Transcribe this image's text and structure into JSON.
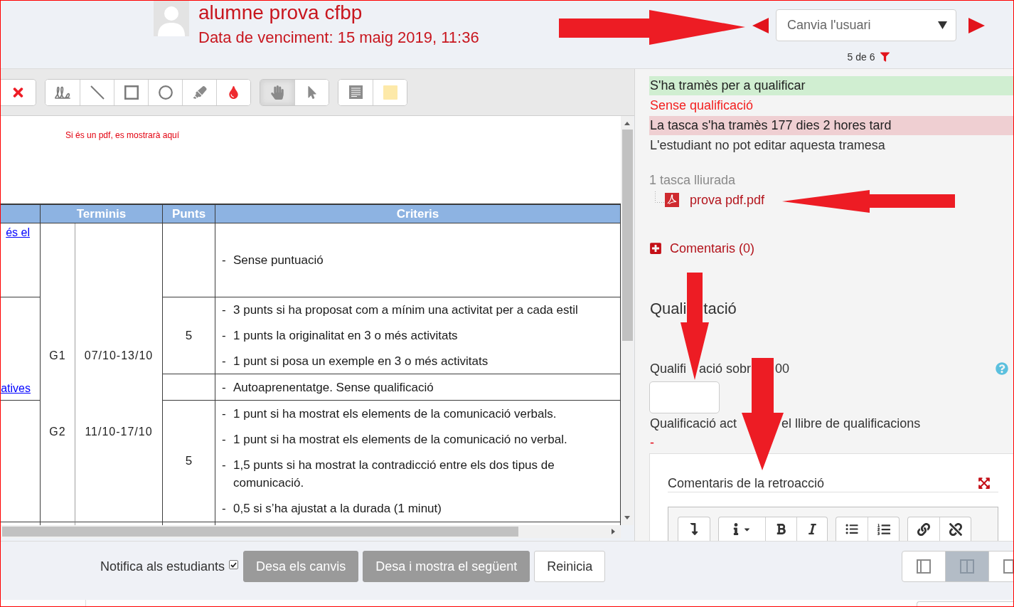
{
  "header": {
    "student_name": "alumne prova cfbp",
    "due_date": "Data de venciment: 15 maig 2019, 11:36",
    "user_select": {
      "value": "Canvia l'usuari"
    },
    "position": "5 de 6"
  },
  "annotation_toolbar": {
    "groups": [
      {
        "tools": [
          {
            "kind": "delete",
            "selected": false
          }
        ]
      },
      {
        "tools": [
          {
            "kind": "pen",
            "selected": false
          },
          {
            "kind": "line",
            "selected": false
          },
          {
            "kind": "rectangle",
            "selected": false
          },
          {
            "kind": "oval",
            "selected": false
          },
          {
            "kind": "highlight",
            "selected": false
          },
          {
            "kind": "color",
            "selected": false
          }
        ]
      },
      {
        "tools": [
          {
            "kind": "hand",
            "selected": true
          },
          {
            "kind": "select",
            "selected": false
          }
        ]
      },
      {
        "tools": [
          {
            "kind": "comment",
            "selected": false
          },
          {
            "kind": "swatch",
            "selected": false
          }
        ]
      }
    ]
  },
  "document": {
    "notice": "Si és un pdf, es mostrarà aquí",
    "table": {
      "header": [
        "Terminis",
        "Punts",
        "Criteris"
      ],
      "column_1": [
        "és el",
        "atives"
      ],
      "groups": [
        {
          "group": "G1",
          "dates": "07/10-13/10"
        },
        {
          "group": "G2",
          "dates": "11/10-17/10"
        }
      ],
      "rows": [
        {
          "criteria": [
            {
              "marker": "-",
              "text": "Sense puntuació"
            }
          ]
        },
        {
          "points": "5",
          "criteria": [
            {
              "marker": "-",
              "text": "3 punts si ha proposat com a mínim una activitat per a cada estil"
            },
            {
              "marker": "-",
              "text": "1 punts la originalitat en 3 o més activitats"
            },
            {
              "marker": "-",
              "text": "1 punt si posa un exemple en 3 o més activitats"
            }
          ]
        },
        {
          "criteria": [
            {
              "marker": "-",
              "text": "Autoaprenentatge. Sense qualificació"
            }
          ]
        },
        {
          "points": "5",
          "criteria": [
            {
              "marker": "-",
              "text": "1 punt si ha mostrat els elements de la comunicació verbals."
            },
            {
              "marker": "-",
              "text": "1 punt si ha mostrat els elements de la comunicació no verbal."
            },
            {
              "marker": "-",
              "text": "1,5 punts si ha mostrat la contradicció entre els dos tipus de comunicació."
            },
            {
              "marker": "-",
              "text": "0,5 si s’ha ajustat a la durada (1 minut)"
            }
          ]
        }
      ]
    }
  },
  "submission": {
    "status": [
      {
        "kind": "success",
        "text": "S'ha tramès per a qualificar"
      },
      {
        "kind": "warning",
        "text": "Sense qualificació"
      },
      {
        "kind": "overdue",
        "text": "La tasca s'ha tramès 177 dies 2 hores tard"
      },
      {
        "kind": "plain",
        "text": "L'estudiant no pot editar aquesta tramesa"
      }
    ],
    "files_title": "1 tasca lliurada",
    "files": [
      "prova pdf.pdf"
    ],
    "comments_link": "Comentaris (0)"
  },
  "grading": {
    "heading_parts": [
      "Quali",
      "tació"
    ],
    "grade_label_parts": [
      "Qualifi",
      "ació sobr",
      "00"
    ],
    "current_label_parts": [
      "Qualificació act",
      "el llibre de qualificacions"
    ],
    "current_value": "-"
  },
  "feedback": {
    "title": "Comentaris de la retroacció",
    "toolbar": [
      [
        {
          "kind": "collapse"
        }
      ],
      [
        {
          "kind": "style"
        },
        {
          "kind": "bold"
        },
        {
          "kind": "italic"
        }
      ],
      [
        {
          "kind": "bullets"
        },
        {
          "kind": "numbers"
        }
      ],
      [
        {
          "kind": "link"
        },
        {
          "kind": "unlink"
        }
      ]
    ]
  },
  "footer": {
    "notify": {
      "label": "Notifica als estudiants",
      "checked": true
    },
    "buttons": [
      {
        "kind": "primary",
        "label": "Desa els canvis"
      },
      {
        "kind": "primary",
        "label": "Desa i mostra el següent"
      },
      {
        "kind": "secondary",
        "label": "Reinicia"
      }
    ],
    "layout_buttons": [
      {
        "kind": "left",
        "selected": false
      },
      {
        "kind": "split",
        "selected": true
      },
      {
        "kind": "right",
        "selected": false
      }
    ]
  }
}
